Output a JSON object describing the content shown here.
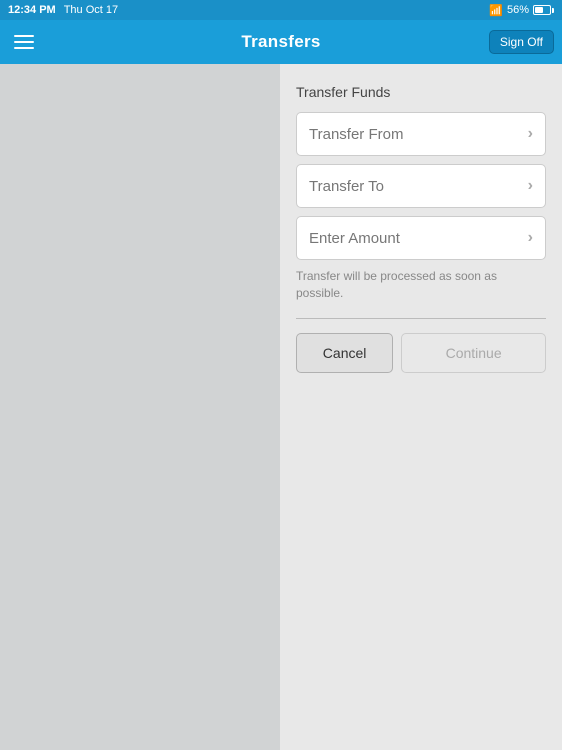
{
  "statusBar": {
    "time": "12:34 PM",
    "date": "Thu Oct 17",
    "signal": "WiFi",
    "battery": "56%"
  },
  "navBar": {
    "title": "Transfers",
    "menuIcon": "menu-icon",
    "signOffLabel": "Sign Off"
  },
  "transferForm": {
    "sectionTitle": "Transfer Funds",
    "fields": [
      {
        "label": "Transfer From",
        "id": "transfer-from"
      },
      {
        "label": "Transfer To",
        "id": "transfer-to"
      },
      {
        "label": "Enter Amount",
        "id": "enter-amount"
      }
    ],
    "infoText": "Transfer will be processed as soon as possible.",
    "cancelLabel": "Cancel",
    "continueLabel": "Continue"
  }
}
